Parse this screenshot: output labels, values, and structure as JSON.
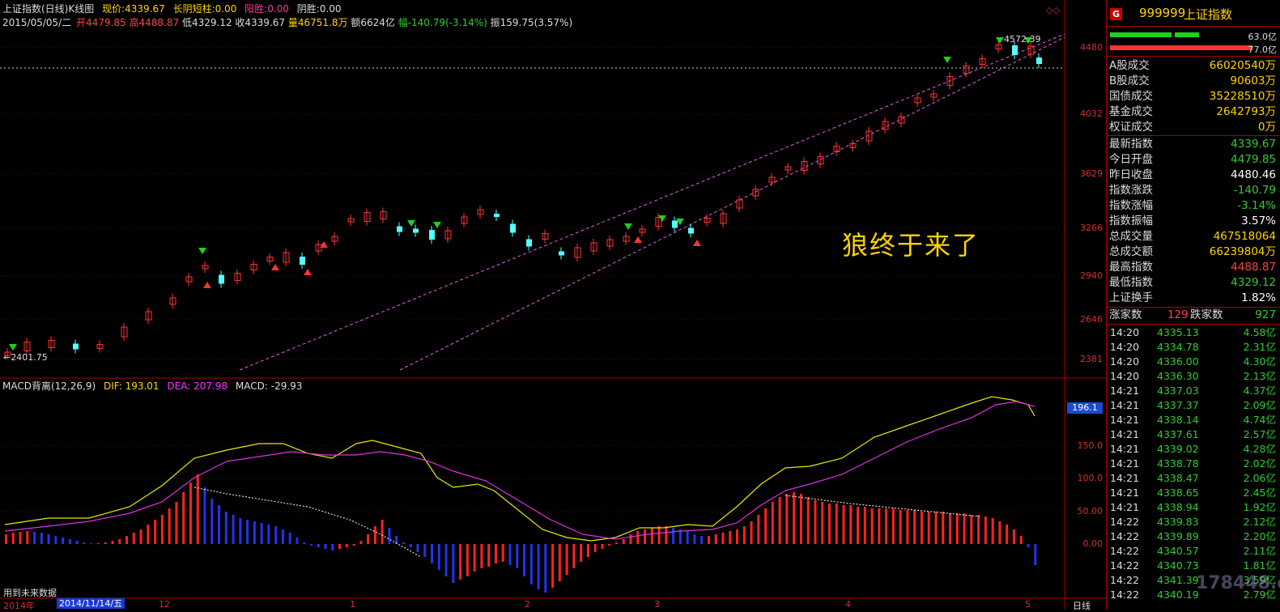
{
  "header": {
    "title": "上证指数(日线)",
    "chart_kind": "K线图",
    "current_label": "现价:",
    "current_value": "4339.67",
    "long_shadow_label": "长阴短柱:",
    "long_shadow_value": "0.00",
    "yang_label": "阳胜:",
    "yang_value": "0.00",
    "yin_label": "阴胜:",
    "yin_value": "0.00",
    "date": "2015/05/05/二",
    "open": "开4479.85",
    "high": "高4488.87",
    "low": "低4329.12",
    "close": "收4339.67",
    "volume": "量46751.8万",
    "amount": "额6624亿",
    "change": "幅-140.79(-3.14%)",
    "amplitude": "振159.75(3.57%)"
  },
  "annotation": "狼终于来了",
  "price_axis": [
    "4480",
    "4032",
    "3629",
    "3266",
    "2940",
    "2646",
    "2381"
  ],
  "low_label": "2401.75",
  "high_label": "4572.39",
  "macd": {
    "title": "MACD背离(12,26,9)",
    "dif": "DIF: 193.01",
    "dea": "DEA: 207.98",
    "macd": "MACD: -29.93",
    "current_tag": "196.1",
    "axis": [
      "150.0",
      "100.0",
      "50.00",
      "0.00"
    ]
  },
  "footer": {
    "note": "用到未来数据",
    "date_box": "2014/11/14/五",
    "months": [
      "2014年",
      "12",
      "1",
      "2",
      "3",
      "4",
      "5"
    ],
    "right_label": "日线"
  },
  "right_panel": {
    "badge": "G",
    "code": "999999",
    "name": "上证指数",
    "bar1_value": "63.0亿",
    "bar2_value": "77.0亿",
    "stats": [
      {
        "label": "A股成交",
        "value": "66020540万",
        "color": "#ffd400"
      },
      {
        "label": "B股成交",
        "value": "90603万",
        "color": "#ffd400"
      },
      {
        "label": "国债成交",
        "value": "35228510万",
        "color": "#ffd400"
      },
      {
        "label": "基金成交",
        "value": "2642793万",
        "color": "#ffd400"
      },
      {
        "label": "权证成交",
        "value": "0万",
        "color": "#ffd400"
      }
    ],
    "quotes": [
      {
        "label": "最新指数",
        "value": "4339.67",
        "color": "#33cc33"
      },
      {
        "label": "今日开盘",
        "value": "4479.85",
        "color": "#33cc33"
      },
      {
        "label": "昨日收盘",
        "value": "4480.46",
        "color": "#ffffff"
      },
      {
        "label": "指数涨跌",
        "value": "-140.79",
        "color": "#33cc33"
      },
      {
        "label": "指数涨幅",
        "value": "-3.14%",
        "color": "#33cc33"
      },
      {
        "label": "指数振幅",
        "value": "3.57%",
        "color": "#ffffff"
      },
      {
        "label": "总成交量",
        "value": "467518064",
        "color": "#ffd400"
      },
      {
        "label": "总成交额",
        "value": "66239804万",
        "color": "#ffd400"
      },
      {
        "label": "最高指数",
        "value": "4488.87",
        "color": "#ff4444"
      },
      {
        "label": "最低指数",
        "value": "4329.12",
        "color": "#33cc33"
      },
      {
        "label": "上证换手",
        "value": "1.82%",
        "color": "#ffffff"
      }
    ],
    "advance_label": "涨家数",
    "advance_value": "129",
    "decline_label": "跌家数",
    "decline_value": "927",
    "ticks": [
      {
        "t": "14:20",
        "p": "4335.13",
        "v": "4.58亿"
      },
      {
        "t": "14:20",
        "p": "4334.78",
        "v": "2.31亿"
      },
      {
        "t": "14:20",
        "p": "4336.00",
        "v": "4.30亿"
      },
      {
        "t": "14:20",
        "p": "4336.30",
        "v": "2.13亿"
      },
      {
        "t": "14:21",
        "p": "4337.03",
        "v": "4.37亿"
      },
      {
        "t": "14:21",
        "p": "4337.37",
        "v": "2.09亿"
      },
      {
        "t": "14:21",
        "p": "4338.14",
        "v": "4.74亿"
      },
      {
        "t": "14:21",
        "p": "4337.61",
        "v": "2.57亿"
      },
      {
        "t": "14:21",
        "p": "4339.02",
        "v": "4.28亿"
      },
      {
        "t": "14:21",
        "p": "4338.78",
        "v": "2.02亿"
      },
      {
        "t": "14:21",
        "p": "4338.47",
        "v": "2.06亿"
      },
      {
        "t": "14:21",
        "p": "4338.65",
        "v": "2.45亿"
      },
      {
        "t": "14:21",
        "p": "4338.94",
        "v": "1.92亿"
      },
      {
        "t": "14:22",
        "p": "4339.83",
        "v": "2.12亿"
      },
      {
        "t": "14:22",
        "p": "4339.89",
        "v": "2.20亿"
      },
      {
        "t": "14:22",
        "p": "4340.57",
        "v": "2.11亿"
      },
      {
        "t": "14:22",
        "p": "4340.73",
        "v": "1.81亿"
      },
      {
        "t": "14:22",
        "p": "4341.39",
        "v": "3.59亿"
      },
      {
        "t": "14:22",
        "p": "4340.19",
        "v": "2.79亿"
      }
    ]
  },
  "watermark": "178448.com"
}
